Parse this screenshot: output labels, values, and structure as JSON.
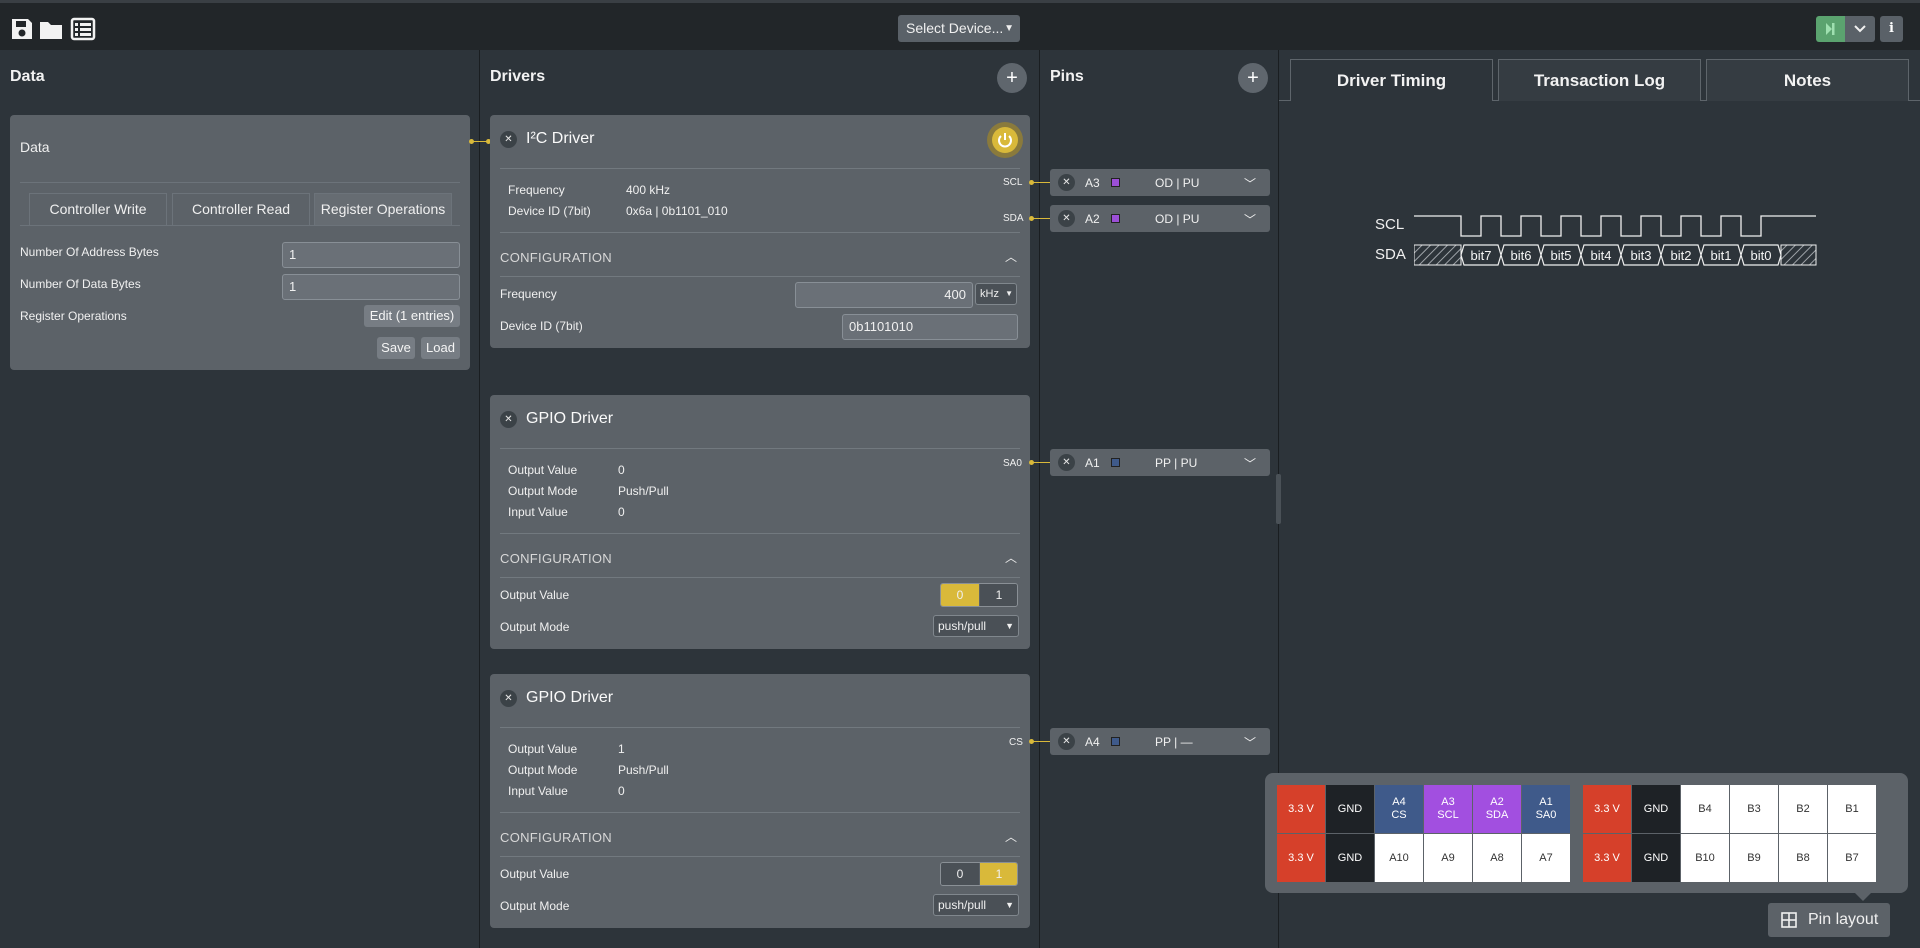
{
  "toolbar": {
    "icons": [
      "save-icon",
      "folder-icon",
      "list-icon"
    ],
    "device_select": "Select Device...",
    "info_label": "i"
  },
  "columns": {
    "data": "Data",
    "drivers": "Drivers",
    "pins": "Pins"
  },
  "data_panel": {
    "title": "Data",
    "tabs": [
      "Controller Write",
      "Controller Read",
      "Register Operations"
    ],
    "active_tab": "Register Operations",
    "fields": {
      "addr_bytes_label": "Number Of Address Bytes",
      "addr_bytes_value": "1",
      "data_bytes_label": "Number Of Data Bytes",
      "data_bytes_value": "1",
      "reg_ops_label": "Register Operations",
      "edit_label": "Edit (1 entries)"
    },
    "save_label": "Save",
    "load_label": "Load"
  },
  "drivers": {
    "i2c": {
      "title": "I²C Driver",
      "freq_label": "Frequency",
      "freq_value": "400 kHz",
      "devid_label": "Device ID (7bit)",
      "devid_value": "0x6a | 0b1101_010",
      "config_label": "CONFIGURATION",
      "cfg_freq_label": "Frequency",
      "cfg_freq_value": "400",
      "cfg_freq_unit": "kHz",
      "cfg_devid_label": "Device ID (7bit)",
      "cfg_devid_value": "0b1101010"
    },
    "gpio1": {
      "title": "GPIO Driver",
      "out_val_label": "Output Value",
      "out_val": "0",
      "out_mode_label": "Output Mode",
      "out_mode": "Push/Pull",
      "in_val_label": "Input Value",
      "in_val": "0",
      "config_label": "CONFIGURATION",
      "cfg_out_val_label": "Output Value",
      "toggle": [
        "0",
        "1"
      ],
      "selected": "0",
      "cfg_out_mode_label": "Output Mode",
      "cfg_out_mode": "push/pull"
    },
    "gpio2": {
      "title": "GPIO Driver",
      "out_val_label": "Output Value",
      "out_val": "1",
      "out_mode_label": "Output Mode",
      "out_mode": "Push/Pull",
      "in_val_label": "Input Value",
      "in_val": "0",
      "config_label": "CONFIGURATION",
      "cfg_out_val_label": "Output Value",
      "toggle": [
        "0",
        "1"
      ],
      "selected": "1",
      "cfg_out_mode_label": "Output Mode",
      "cfg_out_mode": "push/pull"
    }
  },
  "pins": [
    {
      "signal": "SCL",
      "name": "A3",
      "mode": "OD  |  PU",
      "color": "#9b4fd6"
    },
    {
      "signal": "SDA",
      "name": "A2",
      "mode": "OD  |  PU",
      "color": "#9b4fd6"
    },
    {
      "signal": "SA0",
      "name": "A1",
      "mode": "PP  |  PU",
      "color": "#3f5a8a"
    },
    {
      "signal": "CS",
      "name": "A4",
      "mode": "PP  |  —",
      "color": "#3f5a8a"
    }
  ],
  "right_tabs": [
    "Driver Timing",
    "Transaction Log",
    "Notes"
  ],
  "timing": {
    "scl_label": "SCL",
    "sda_label": "SDA",
    "bits": [
      "bit7",
      "bit6",
      "bit5",
      "bit4",
      "bit3",
      "bit2",
      "bit1",
      "bit0"
    ]
  },
  "pin_layout": {
    "button_label": "Pin layout",
    "row1": [
      {
        "l1": "3.3 V",
        "l2": "",
        "kind": "power"
      },
      {
        "l1": "GND",
        "l2": "",
        "kind": "gnd"
      },
      {
        "l1": "A4",
        "l2": "CS",
        "kind": "blue"
      },
      {
        "l1": "A3",
        "l2": "SCL",
        "kind": "purple"
      },
      {
        "l1": "A2",
        "l2": "SDA",
        "kind": "purple"
      },
      {
        "l1": "A1",
        "l2": "SA0",
        "kind": "blue"
      },
      {
        "l1": "3.3 V",
        "l2": "",
        "kind": "power"
      },
      {
        "l1": "GND",
        "l2": "",
        "kind": "gnd"
      },
      {
        "l1": "B4",
        "l2": "",
        "kind": "free"
      },
      {
        "l1": "B3",
        "l2": "",
        "kind": "free"
      },
      {
        "l1": "B2",
        "l2": "",
        "kind": "free"
      },
      {
        "l1": "B1",
        "l2": "",
        "kind": "free"
      }
    ],
    "row2": [
      {
        "l1": "3.3 V",
        "l2": "",
        "kind": "power"
      },
      {
        "l1": "GND",
        "l2": "",
        "kind": "gnd"
      },
      {
        "l1": "A10",
        "l2": "",
        "kind": "free"
      },
      {
        "l1": "A9",
        "l2": "",
        "kind": "free"
      },
      {
        "l1": "A8",
        "l2": "",
        "kind": "free"
      },
      {
        "l1": "A7",
        "l2": "",
        "kind": "free"
      },
      {
        "l1": "3.3 V",
        "l2": "",
        "kind": "power"
      },
      {
        "l1": "GND",
        "l2": "",
        "kind": "gnd"
      },
      {
        "l1": "B10",
        "l2": "",
        "kind": "free"
      },
      {
        "l1": "B9",
        "l2": "",
        "kind": "free"
      },
      {
        "l1": "B8",
        "l2": "",
        "kind": "free"
      },
      {
        "l1": "B7",
        "l2": "",
        "kind": "free"
      }
    ]
  },
  "colors": {
    "power": "#d6402a",
    "gnd": "#1e2226",
    "blue": "#3f5a8a",
    "purple": "#a24fe0",
    "free": "#ffffff",
    "accent": "#d9b93a",
    "run": "#5ba36f"
  }
}
